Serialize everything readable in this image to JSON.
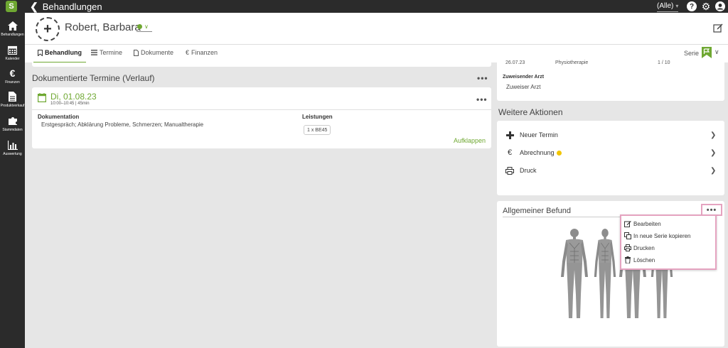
{
  "topbar": {
    "logo": "S",
    "title": "Behandlungen",
    "filter": "(Alle)",
    "icons": [
      "chevron-left-icon",
      "help-icon",
      "gear-icon",
      "user-icon"
    ]
  },
  "sidebar": {
    "items": [
      {
        "icon": "home-icon",
        "label": "Behandlungen"
      },
      {
        "icon": "calendar-icon",
        "label": "Kalender"
      },
      {
        "icon": "euro-icon",
        "label": "Finanzen"
      },
      {
        "icon": "document-icon",
        "label": "Produktverkauf"
      },
      {
        "icon": "puzzle-icon",
        "label": "Stammdaten"
      },
      {
        "icon": "chart-icon",
        "label": "Auswertung"
      }
    ]
  },
  "patient": {
    "name": "Robert, Barbara",
    "status_color": "#6fa832"
  },
  "tabs": [
    {
      "label": "Behandlung",
      "icon": "bookmark-icon"
    },
    {
      "label": "Termine",
      "icon": "list-icon"
    },
    {
      "label": "Dokumente",
      "icon": "file-icon"
    },
    {
      "label": "Finanzen",
      "icon": "euro-icon"
    }
  ],
  "serie": {
    "label": "Serie"
  },
  "history": {
    "title": "Dokumentierte Termine (Verlauf)",
    "more": "•••",
    "appointment": {
      "date": "Di, 01.08.23",
      "time": "10:00–10:45 | 45min",
      "doc_label": "Dokumentation",
      "doc_text": "Erstgespräch; Abklärung Probleme, Schmerzen; Manualtherapie",
      "leistungen_label": "Leistungen",
      "leistungen_chip": "1 x BE45",
      "expand": "Aufklappen",
      "more": "•••"
    }
  },
  "right": {
    "row_date": "26.07.23",
    "row_therapy": "Physiotherapie",
    "row_count": "1 / 10",
    "arzt_label": "Zuweisender Arzt",
    "arzt_value": "Zuweiser Arzt",
    "aktionen_title": "Weitere Aktionen",
    "actions": [
      {
        "label": "Neuer Termin",
        "icon": "plus-icon"
      },
      {
        "label": "Abrechnung",
        "icon": "euro-icon"
      },
      {
        "label": "Druck",
        "icon": "printer-icon"
      }
    ],
    "befund_title": "Allgemeiner Befund",
    "befund_more": "•••"
  },
  "menu": {
    "items": [
      {
        "label": "Bearbeiten",
        "icon": "edit-icon"
      },
      {
        "label": "In neue Serie kopieren",
        "icon": "copy-icon"
      },
      {
        "label": "Drucken",
        "icon": "printer-icon"
      },
      {
        "label": "Löschen",
        "icon": "trash-icon"
      }
    ]
  },
  "colors": {
    "accent": "#6fa832",
    "dark": "#2b2b2b",
    "highlight": "#e5a3c0",
    "warning": "#f2c500"
  }
}
